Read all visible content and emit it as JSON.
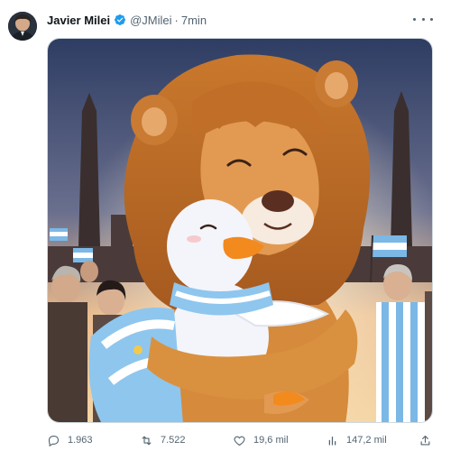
{
  "tweet": {
    "author": {
      "display_name": "Javier Milei",
      "handle": "@JMilei",
      "verified": true
    },
    "separator": "·",
    "time": "7min",
    "image": {
      "subject": "lion-hugging-duck-artwork"
    },
    "actions": {
      "replies": "1.963",
      "retweets": "7.522",
      "likes": "19,6 mil",
      "views": "147,2 mil"
    }
  },
  "colors": {
    "text_primary": "#0f1419",
    "text_secondary": "#536471",
    "verified_blue": "#1d9bf0",
    "border": "#cfd9de"
  },
  "icons": {
    "reply": "reply-icon",
    "retweet": "retweet-icon",
    "like": "heart-icon",
    "views": "views-icon",
    "share": "share-icon",
    "more": "more-icon",
    "verified": "verified-badge-icon"
  }
}
